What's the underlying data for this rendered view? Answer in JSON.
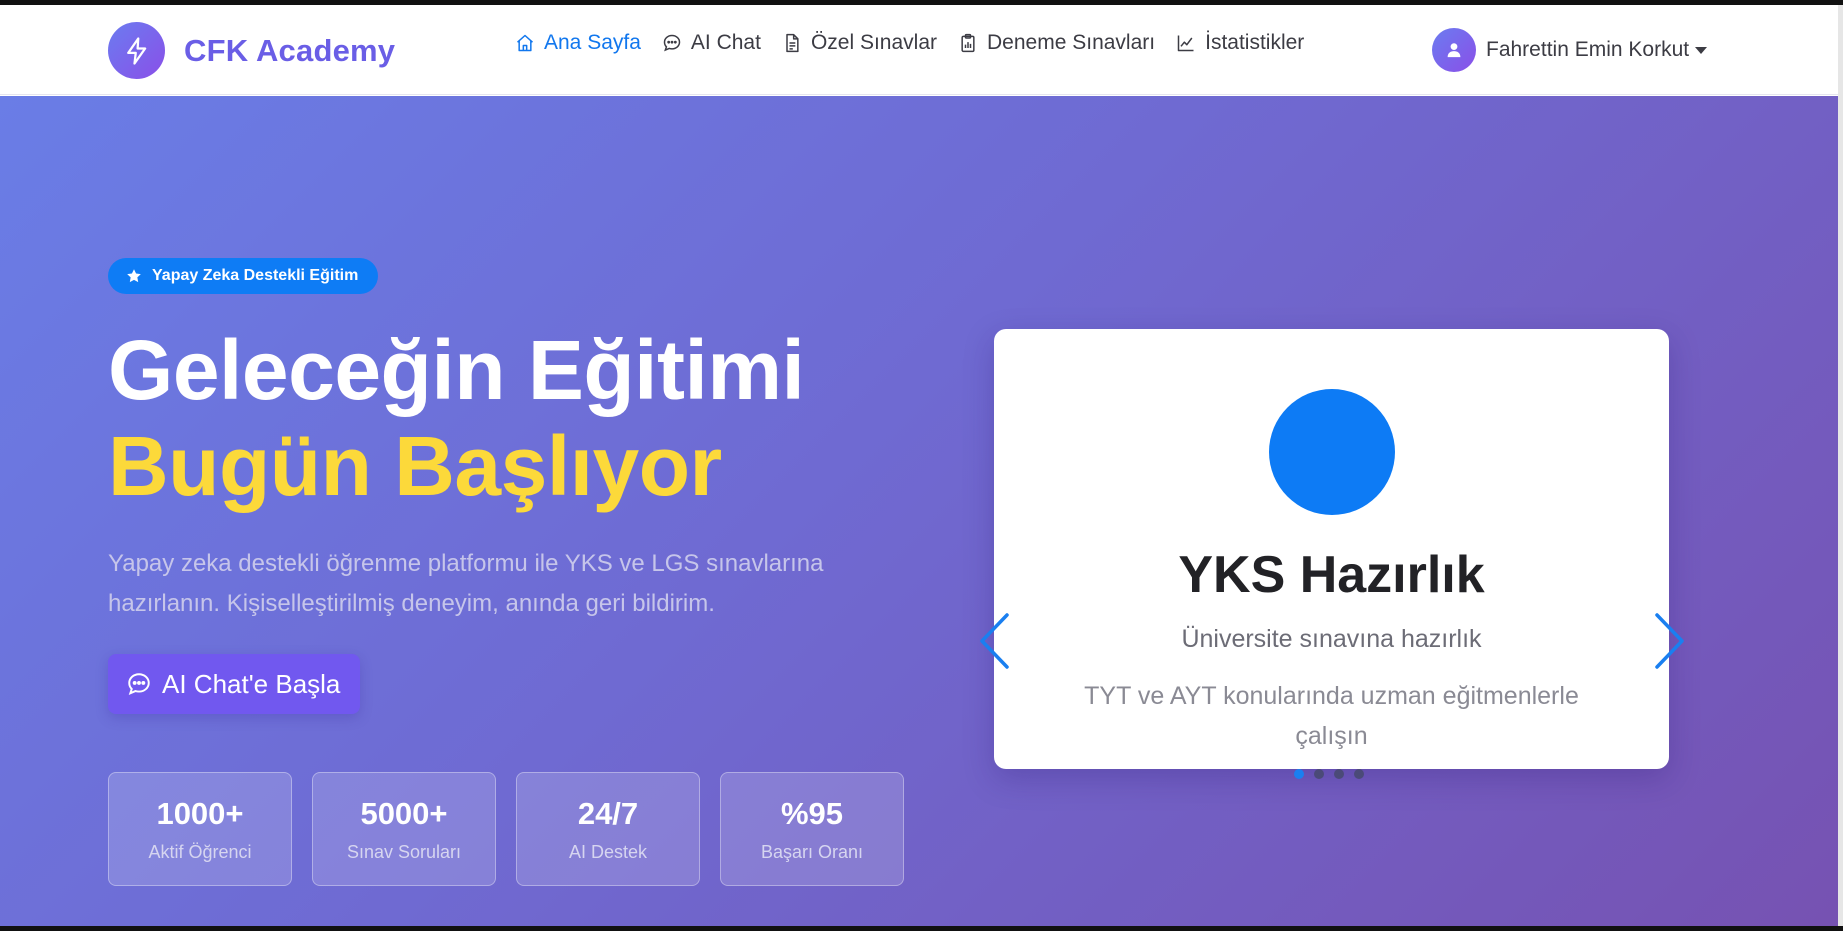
{
  "colors": {
    "accent": "#6a5ee6",
    "active_link": "#1177ee",
    "highlight": "#fcd93a",
    "badge": "#0e7cf5",
    "cta": "#7158ef",
    "hero_gradient_start": "#6a7de6",
    "hero_gradient_end": "#7652b2"
  },
  "brand": {
    "name": "CFK Academy",
    "icon": "lightning-icon"
  },
  "nav": {
    "items": [
      {
        "label": "Ana Sayfa",
        "icon": "home-icon",
        "active": true
      },
      {
        "label": "AI Chat",
        "icon": "chat-icon",
        "active": false
      },
      {
        "label": "Özel Sınavlar",
        "icon": "document-icon",
        "active": false
      },
      {
        "label": "Deneme Sınavları",
        "icon": "clipboard-chart-icon",
        "active": false
      },
      {
        "label": "İstatistikler",
        "icon": "line-chart-icon",
        "active": false
      }
    ]
  },
  "user": {
    "name": "Fahrettin Emin Korkut",
    "icon": "user-icon"
  },
  "hero": {
    "badge": "Yapay Zeka Destekli Eğitim",
    "title_line1": "Geleceğin Eğitimi",
    "title_line2": "Bugün Başlıyor",
    "subtitle": "Yapay zeka destekli öğrenme platformu ile YKS ve LGS sınavlarına hazırlanın. Kişiselleştirilmiş deneyim, anında geri bildirim.",
    "cta_label": "AI Chat'e Başla",
    "stats": [
      {
        "value": "1000+",
        "label": "Aktif Öğrenci"
      },
      {
        "value": "5000+",
        "label": "Sınav Soruları"
      },
      {
        "value": "24/7",
        "label": "AI Destek"
      },
      {
        "value": "%95",
        "label": "Başarı Oranı"
      }
    ]
  },
  "carousel": {
    "slide": {
      "title": "YKS Hazırlık",
      "subtitle": "Üniversite sınavına hazırlık",
      "description": "TYT ve AYT konularında uzman eğitmenlerle çalışın"
    },
    "slide_count": 4,
    "active_index": 0
  }
}
